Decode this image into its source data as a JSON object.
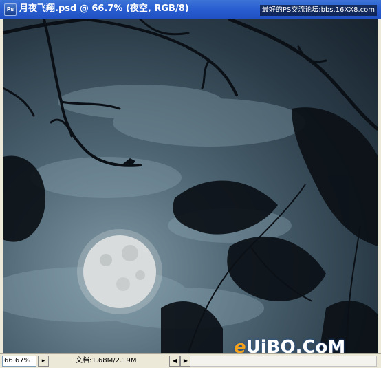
{
  "window": {
    "title": "月夜飞翔.psd @ 66.7% (夜空, RGB/8)",
    "app_icon": "photoshop-icon",
    "icon_text": "Ps"
  },
  "watermark_top": "最好的PS交流论坛:bbs.16XX8.com",
  "canvas": {
    "moon_color": "#d9dcdc",
    "sky_color": "#2a3b47"
  },
  "statusbar": {
    "zoom": "66.67%",
    "doc_info": "文档:1.68M/2.19M",
    "prev_icon": "triangle-right-icon",
    "left_arrow": "◀",
    "right_arrow": "▶"
  },
  "site_logo": {
    "e": "e",
    "rest": "UiBQ.CoM"
  }
}
